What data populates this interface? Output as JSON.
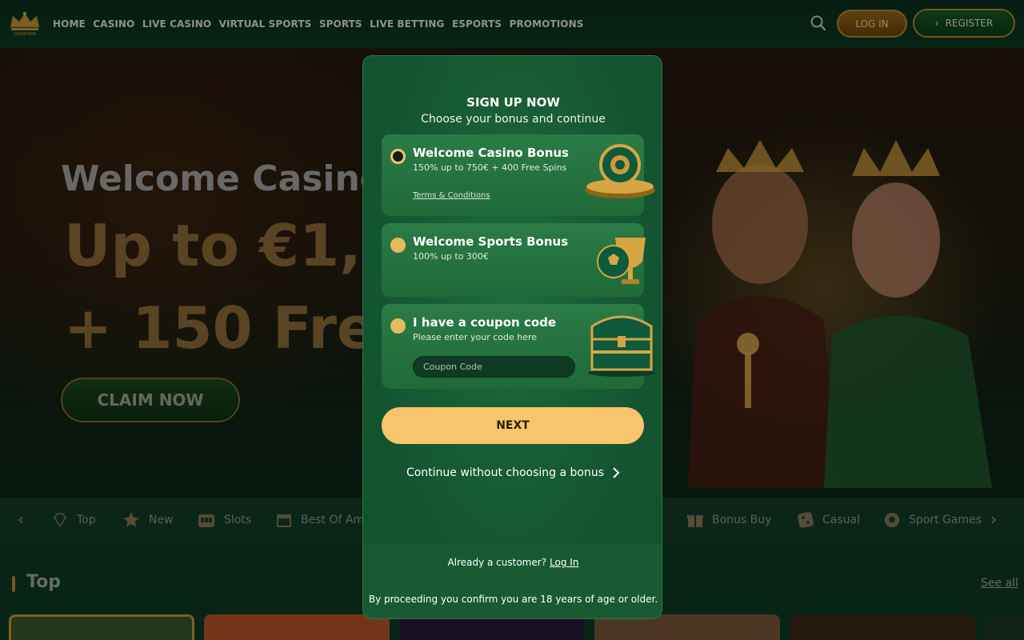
{
  "header": {
    "logo_text": "GRANDWIN",
    "nav": [
      "HOME",
      "CASINO",
      "LIVE CASINO",
      "VIRTUAL SPORTS",
      "SPORTS",
      "LIVE BETTING",
      "ESPORTS",
      "PROMOTIONS"
    ],
    "login_label": "LOG IN",
    "register_label": "REGISTER"
  },
  "hero": {
    "title": "Welcome Casino",
    "amount": "Up to €1,200",
    "spins": "+ 150 Free Spins",
    "cta": "CLAIM NOW"
  },
  "categories": [
    {
      "label": "Top",
      "icon": "diamond-icon"
    },
    {
      "label": "New",
      "icon": "star-icon"
    },
    {
      "label": "Slots",
      "icon": "slot-machine-icon"
    },
    {
      "label": "Best Of Am",
      "icon": "calendar-icon"
    },
    {
      "label": "Bonus Buy",
      "icon": "gift-icon"
    },
    {
      "label": "Casual",
      "icon": "dice-icon"
    },
    {
      "label": "Sport Games",
      "icon": "soccer-ball-icon"
    }
  ],
  "section": {
    "title": "Top",
    "see_all": "See all"
  },
  "modal": {
    "title": "SIGN UP NOW",
    "subtitle": "Choose your bonus and continue",
    "options": [
      {
        "title": "Welcome Casino Bonus",
        "desc": "150% up to 750€ + 400 Free Spins",
        "link": "Terms & Conditions",
        "selected": true
      },
      {
        "title": "Welcome Sports Bonus",
        "desc": "100% up to 300€",
        "selected": false
      },
      {
        "title": "I have a coupon code",
        "desc": "Please enter your code here",
        "placeholder": "Coupon Code",
        "selected": false
      }
    ],
    "next_label": "NEXT",
    "continue_label": "Continue without choosing a bonus",
    "already_text": "Already a customer?",
    "login_link": "Log In",
    "age_notice": "By proceeding you confirm you are 18 years of age or older."
  },
  "colors": {
    "accent_gold": "#f7c56b",
    "brand_green": "#135330",
    "header_bg": "#0a2e1c"
  }
}
